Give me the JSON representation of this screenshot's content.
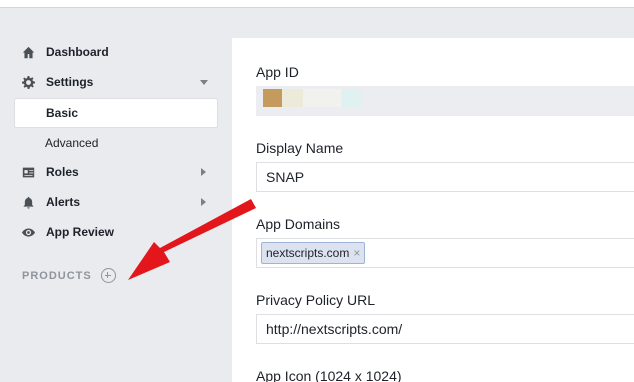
{
  "sidebar": {
    "items": [
      {
        "label": "Dashboard",
        "icon": "home-icon"
      },
      {
        "label": "Settings",
        "icon": "gear-icon"
      },
      {
        "label": "Basic"
      },
      {
        "label": "Advanced"
      },
      {
        "label": "Roles",
        "icon": "id-card-icon"
      },
      {
        "label": "Alerts",
        "icon": "bell-icon"
      },
      {
        "label": "App Review",
        "icon": "eye-icon"
      }
    ],
    "products_label": "PRODUCTS"
  },
  "form": {
    "app_id_label": "App ID",
    "display_name_label": "Display Name",
    "display_name_value": "SNAP",
    "app_domains_label": "App Domains",
    "app_domains_tag": "nextscripts.com",
    "tag_remove": "×",
    "privacy_label": "Privacy Policy URL",
    "privacy_value": "http://nextscripts.com/",
    "app_icon_label": "App Icon (1024 x 1024)"
  },
  "colors": {
    "annotation_arrow": "#e3161b",
    "sidebar_bg": "#e9ebee",
    "tag_bg": "#dce2ef"
  }
}
